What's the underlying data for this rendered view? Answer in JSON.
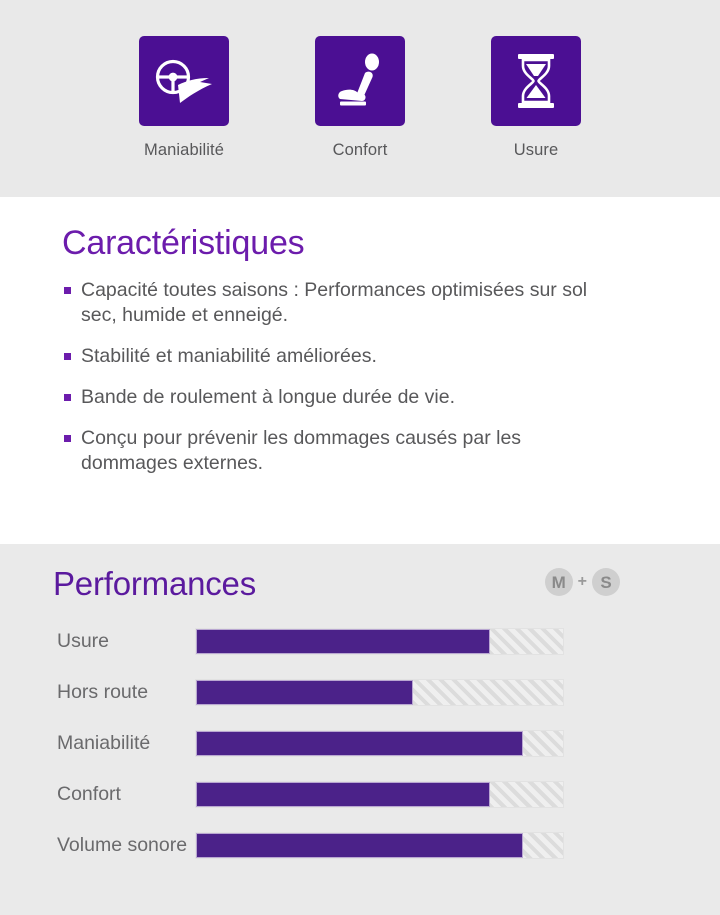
{
  "top_icons": [
    {
      "label": "Maniabilité",
      "icon": "steering-wheel-road-icon"
    },
    {
      "label": "Confort",
      "icon": "car-seat-icon"
    },
    {
      "label": "Usure",
      "icon": "hourglass-icon"
    }
  ],
  "features": {
    "title": "Caractéristiques",
    "items": [
      "Capacité toutes saisons : Performances optimisées sur sol sec, humide et enneigé.",
      "Stabilité et maniabilité améliorées.",
      "Bande de roulement à longue durée de vie.",
      "Conçu pour prévenir les dommages causés par les dommages externes."
    ]
  },
  "performance": {
    "title": "Performances",
    "badge": {
      "left": "M",
      "plus": "+",
      "right": "S"
    },
    "chart_data": {
      "type": "bar",
      "title": "Performances",
      "xlabel": "",
      "ylabel": "",
      "xlim": [
        0,
        100
      ],
      "grid": false,
      "legend": "none",
      "orientation": "horizontal",
      "categories": [
        "Usure",
        "Hors route",
        "Maniabilité",
        "Confort",
        "Volume sonore"
      ],
      "values": [
        80,
        59,
        89,
        80,
        89
      ],
      "unit": "%"
    }
  },
  "colors": {
    "purple_tile": "#4b0f93",
    "purple_title": "#6c1cac",
    "bar_fill": "#4b2289",
    "track": "#dcdcdc",
    "text_gray": "#58585a",
    "bg_gray": "#eaeaea",
    "bg_white": "#ffffff",
    "badge_gray": "#cfcfcf"
  }
}
